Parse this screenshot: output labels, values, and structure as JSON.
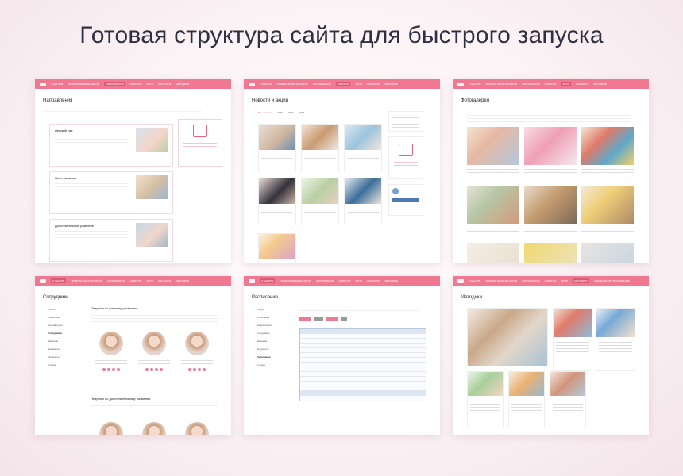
{
  "headline": "Готовая структура сайта для быстрого запуска",
  "nav": [
    "О центре",
    "Правила безопасности",
    "Направления",
    "Новости",
    "Фото",
    "Контакты",
    "Методики",
    "Сведения об организации"
  ],
  "cards": {
    "directions": {
      "title": "Направления",
      "items": [
        "Детский сад",
        "Ясли развития",
        "Дополнительное развитие"
      ]
    },
    "news": {
      "title": "Новости и акции",
      "tabs": [
        "Все новости",
        "2015",
        "2016",
        "2017"
      ]
    },
    "gallery": {
      "title": "Фотогалерея"
    },
    "staff": {
      "title": "Сотрудники",
      "menu": [
        "Услуги",
        "Специфика",
        "Направления",
        "Сотрудники",
        "Вакансии",
        "Документы",
        "Реквизиты",
        "Отзывы"
      ],
      "section1": "Педагоги по раннему развитию",
      "section2": "Педагоги по дополнительному развитию"
    },
    "schedule": {
      "title": "Расписание",
      "menu": [
        "Услуги",
        "Специфика",
        "Направления",
        "Сотрудники",
        "Вакансии",
        "Документы",
        "Расписание",
        "Отзывы"
      ]
    },
    "methods": {
      "title": "Методики"
    }
  }
}
